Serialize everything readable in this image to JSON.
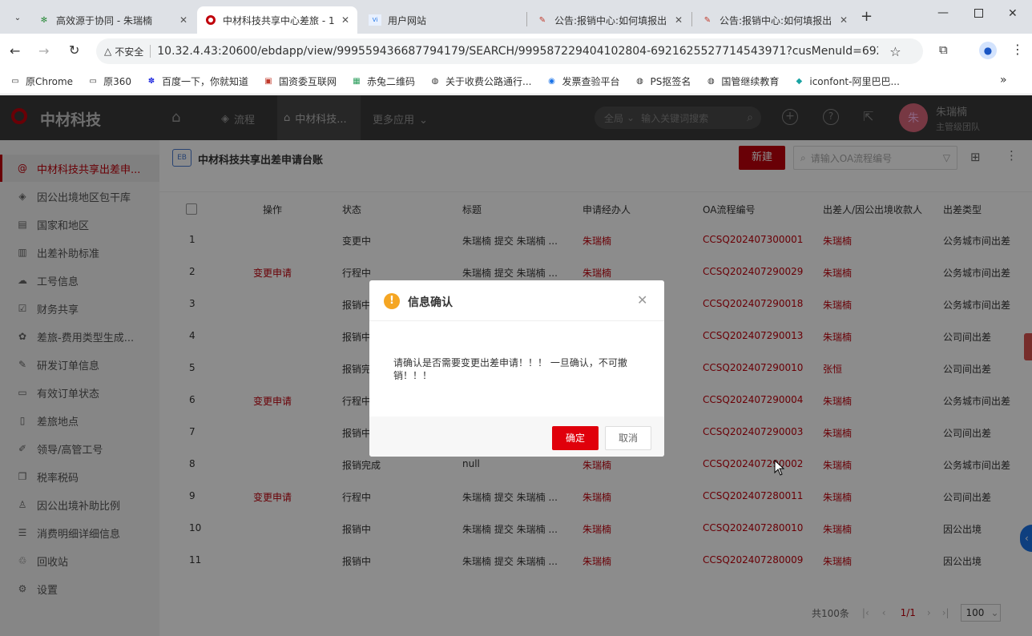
{
  "browser": {
    "tabs": [
      {
        "title": "高效源于协同 - 朱瑞楠",
        "icon": "gear-icon"
      },
      {
        "title": "中材科技共享中心差旅 - 1",
        "icon": "sinoma-logo-icon"
      },
      {
        "title": "用户网站",
        "icon": "site-icon"
      },
      {
        "title": "公告:报销中心:如何填报出",
        "icon": "notice-icon"
      },
      {
        "title": "公告:报销中心:如何填报出",
        "icon": "notice-icon"
      }
    ],
    "insecure_label": "不安全",
    "url": "10.32.4.43:20600/ebdapp/view/999559436687794179/SEARCH/999587229404102804-6921625527714543971?cusMenuId=69216255...",
    "bookmarks": [
      "原Chrome",
      "原360",
      "百度一下，你就知道",
      "国资委互联网",
      "赤兔二维码",
      "关于收费公路通行...",
      "发票查验平台",
      "PS抠签名",
      "国管继续教育",
      "iconfont-阿里巴巴..."
    ]
  },
  "app": {
    "logo_text": "中材科技",
    "nav": [
      "流程",
      "中材科技...",
      "更多应用"
    ],
    "search_scope": "全局",
    "search_placeholder": "输入关键词搜索",
    "user_name": "朱瑞楠",
    "user_dept": "主管级团队",
    "avatar_char": "朱"
  },
  "sidebar": {
    "items": [
      {
        "label": "中材科技共享出差申...",
        "icon": "at-icon"
      },
      {
        "label": "因公出境地区包干库",
        "icon": "layers-icon"
      },
      {
        "label": "国家和地区",
        "icon": "table-icon"
      },
      {
        "label": "出差补助标准",
        "icon": "chart-icon"
      },
      {
        "label": "工号信息",
        "icon": "cloud-icon"
      },
      {
        "label": "财务共享",
        "icon": "check-icon"
      },
      {
        "label": "差旅-费用类型生成...",
        "icon": "stamp-icon"
      },
      {
        "label": "研发订单信息",
        "icon": "pen-icon"
      },
      {
        "label": "有效订单状态",
        "icon": "monitor-icon"
      },
      {
        "label": "差旅地点",
        "icon": "doc-icon"
      },
      {
        "label": "领导/高管工号",
        "icon": "edit-icon"
      },
      {
        "label": "税率税码",
        "icon": "copy-icon"
      },
      {
        "label": "因公出境补助比例",
        "icon": "user-icon"
      },
      {
        "label": "消费明细详细信息",
        "icon": "list-icon"
      },
      {
        "label": "回收站",
        "icon": "trash-icon"
      },
      {
        "label": "设置",
        "icon": "settings-icon"
      }
    ]
  },
  "page": {
    "badge": "EB",
    "title": "中材科技共享出差申请台账",
    "new_button": "新建",
    "search_placeholder": "请输入OA流程编号"
  },
  "table": {
    "headers": [
      "操作",
      "状态",
      "标题",
      "申请经办人",
      "OA流程编号",
      "出差人/因公出境收款人",
      "出差类型"
    ],
    "rows": [
      {
        "no": "1",
        "op": "",
        "status": "变更中",
        "title": "朱瑞楠 提交 朱瑞楠 ...",
        "applicant": "朱瑞楠",
        "oa": "CCSQ202407300001",
        "traveler": "朱瑞楠",
        "type": "公务城市间出差"
      },
      {
        "no": "2",
        "op": "变更申请",
        "status": "行程中",
        "title": "朱瑞楠 提交 朱瑞楠 ...",
        "applicant": "朱瑞楠",
        "oa": "CCSQ202407290029",
        "traveler": "朱瑞楠",
        "type": "公务城市间出差"
      },
      {
        "no": "3",
        "op": "",
        "status": "报销中",
        "title": "",
        "applicant": "",
        "oa": "CCSQ202407290018",
        "traveler": "朱瑞楠",
        "type": "公务城市间出差"
      },
      {
        "no": "4",
        "op": "",
        "status": "报销中",
        "title": "",
        "applicant": "",
        "oa": "CCSQ202407290013",
        "traveler": "朱瑞楠",
        "type": "公司间出差"
      },
      {
        "no": "5",
        "op": "",
        "status": "报销完",
        "title": "",
        "applicant": "",
        "oa": "CCSQ202407290010",
        "traveler": "张恒",
        "type": "公司间出差"
      },
      {
        "no": "6",
        "op": "变更申请",
        "status": "行程中",
        "title": "",
        "applicant": "",
        "oa": "CCSQ202407290004",
        "traveler": "朱瑞楠",
        "type": "公务城市间出差"
      },
      {
        "no": "7",
        "op": "",
        "status": "报销中",
        "title": "",
        "applicant": "",
        "oa": "CCSQ202407290003",
        "traveler": "朱瑞楠",
        "type": "公司间出差"
      },
      {
        "no": "8",
        "op": "",
        "status": "报销完成",
        "title": "null",
        "applicant": "朱瑞楠",
        "oa": "CCSQ202407290002",
        "traveler": "朱瑞楠",
        "type": "公务城市间出差"
      },
      {
        "no": "9",
        "op": "变更申请",
        "status": "行程中",
        "title": "朱瑞楠 提交 朱瑞楠 ...",
        "applicant": "朱瑞楠",
        "oa": "CCSQ202407280011",
        "traveler": "朱瑞楠",
        "type": "公司间出差"
      },
      {
        "no": "10",
        "op": "",
        "status": "报销中",
        "title": "朱瑞楠 提交 朱瑞楠 ...",
        "applicant": "朱瑞楠",
        "oa": "CCSQ202407280010",
        "traveler": "朱瑞楠",
        "type": "因公出境"
      },
      {
        "no": "11",
        "op": "",
        "status": "报销中",
        "title": "朱瑞楠 提交 朱瑞楠 ...",
        "applicant": "朱瑞楠",
        "oa": "CCSQ202407280009",
        "traveler": "朱瑞楠",
        "type": "因公出境"
      }
    ]
  },
  "pagination": {
    "total": "共100条",
    "page": "1/1",
    "page_size": "100"
  },
  "dialog": {
    "title": "信息确认",
    "message": "请确认是否需要变更出差申请！！！ 一旦确认，不可撤销！！！",
    "confirm": "确定",
    "cancel": "取消"
  },
  "colors": {
    "accent": "#c0000b",
    "header_bg": "#3a3a3a"
  }
}
